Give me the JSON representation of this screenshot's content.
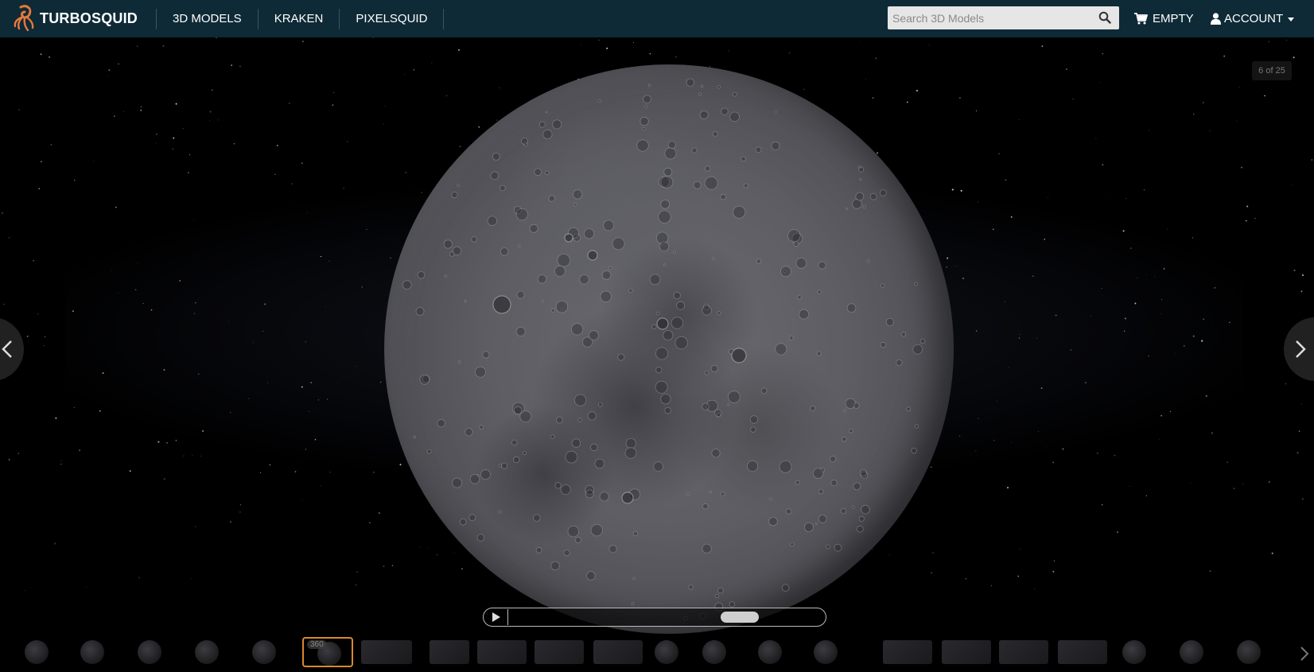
{
  "brand": {
    "name": "TURBOSQUID",
    "accent": "#e8793a"
  },
  "nav": {
    "items": [
      {
        "label": "3D MODELS"
      },
      {
        "label": "KRAKEN"
      },
      {
        "label": "PIXELSQUID"
      }
    ]
  },
  "search": {
    "placeholder": "Search 3D Models",
    "value": "",
    "icon": "search-icon"
  },
  "cart": {
    "label": "EMPTY",
    "icon": "cart-icon"
  },
  "account": {
    "label": "ACCOUNT",
    "icon": "user-icon"
  },
  "viewer": {
    "counter": "6 of 25",
    "prev_icon": "chevron-left-icon",
    "next_icon": "chevron-right-icon",
    "player": {
      "play_icon": "play-icon",
      "progress": 0.78
    }
  },
  "thumbnails": {
    "active_index": 5,
    "active_badge": "360",
    "items": [
      {
        "kind": "sphere"
      },
      {
        "kind": "sphere"
      },
      {
        "kind": "sphere"
      },
      {
        "kind": "sphere"
      },
      {
        "kind": "sphere"
      },
      {
        "kind": "sphere-360"
      },
      {
        "kind": "texture"
      },
      {
        "kind": "texture"
      },
      {
        "kind": "texture"
      },
      {
        "kind": "texture"
      },
      {
        "kind": "texture"
      },
      {
        "kind": "sphere"
      },
      {
        "kind": "sphere"
      },
      {
        "kind": "sphere"
      },
      {
        "kind": "sphere"
      },
      {
        "kind": "panel"
      },
      {
        "kind": "panel"
      },
      {
        "kind": "panel"
      },
      {
        "kind": "panel"
      },
      {
        "kind": "sphere"
      },
      {
        "kind": "sphere"
      },
      {
        "kind": "sphere"
      }
    ],
    "next_icon": "chevron-right-icon"
  },
  "colors": {
    "nav_bg": "#0e2a36",
    "active_border": "#d88a2c"
  }
}
